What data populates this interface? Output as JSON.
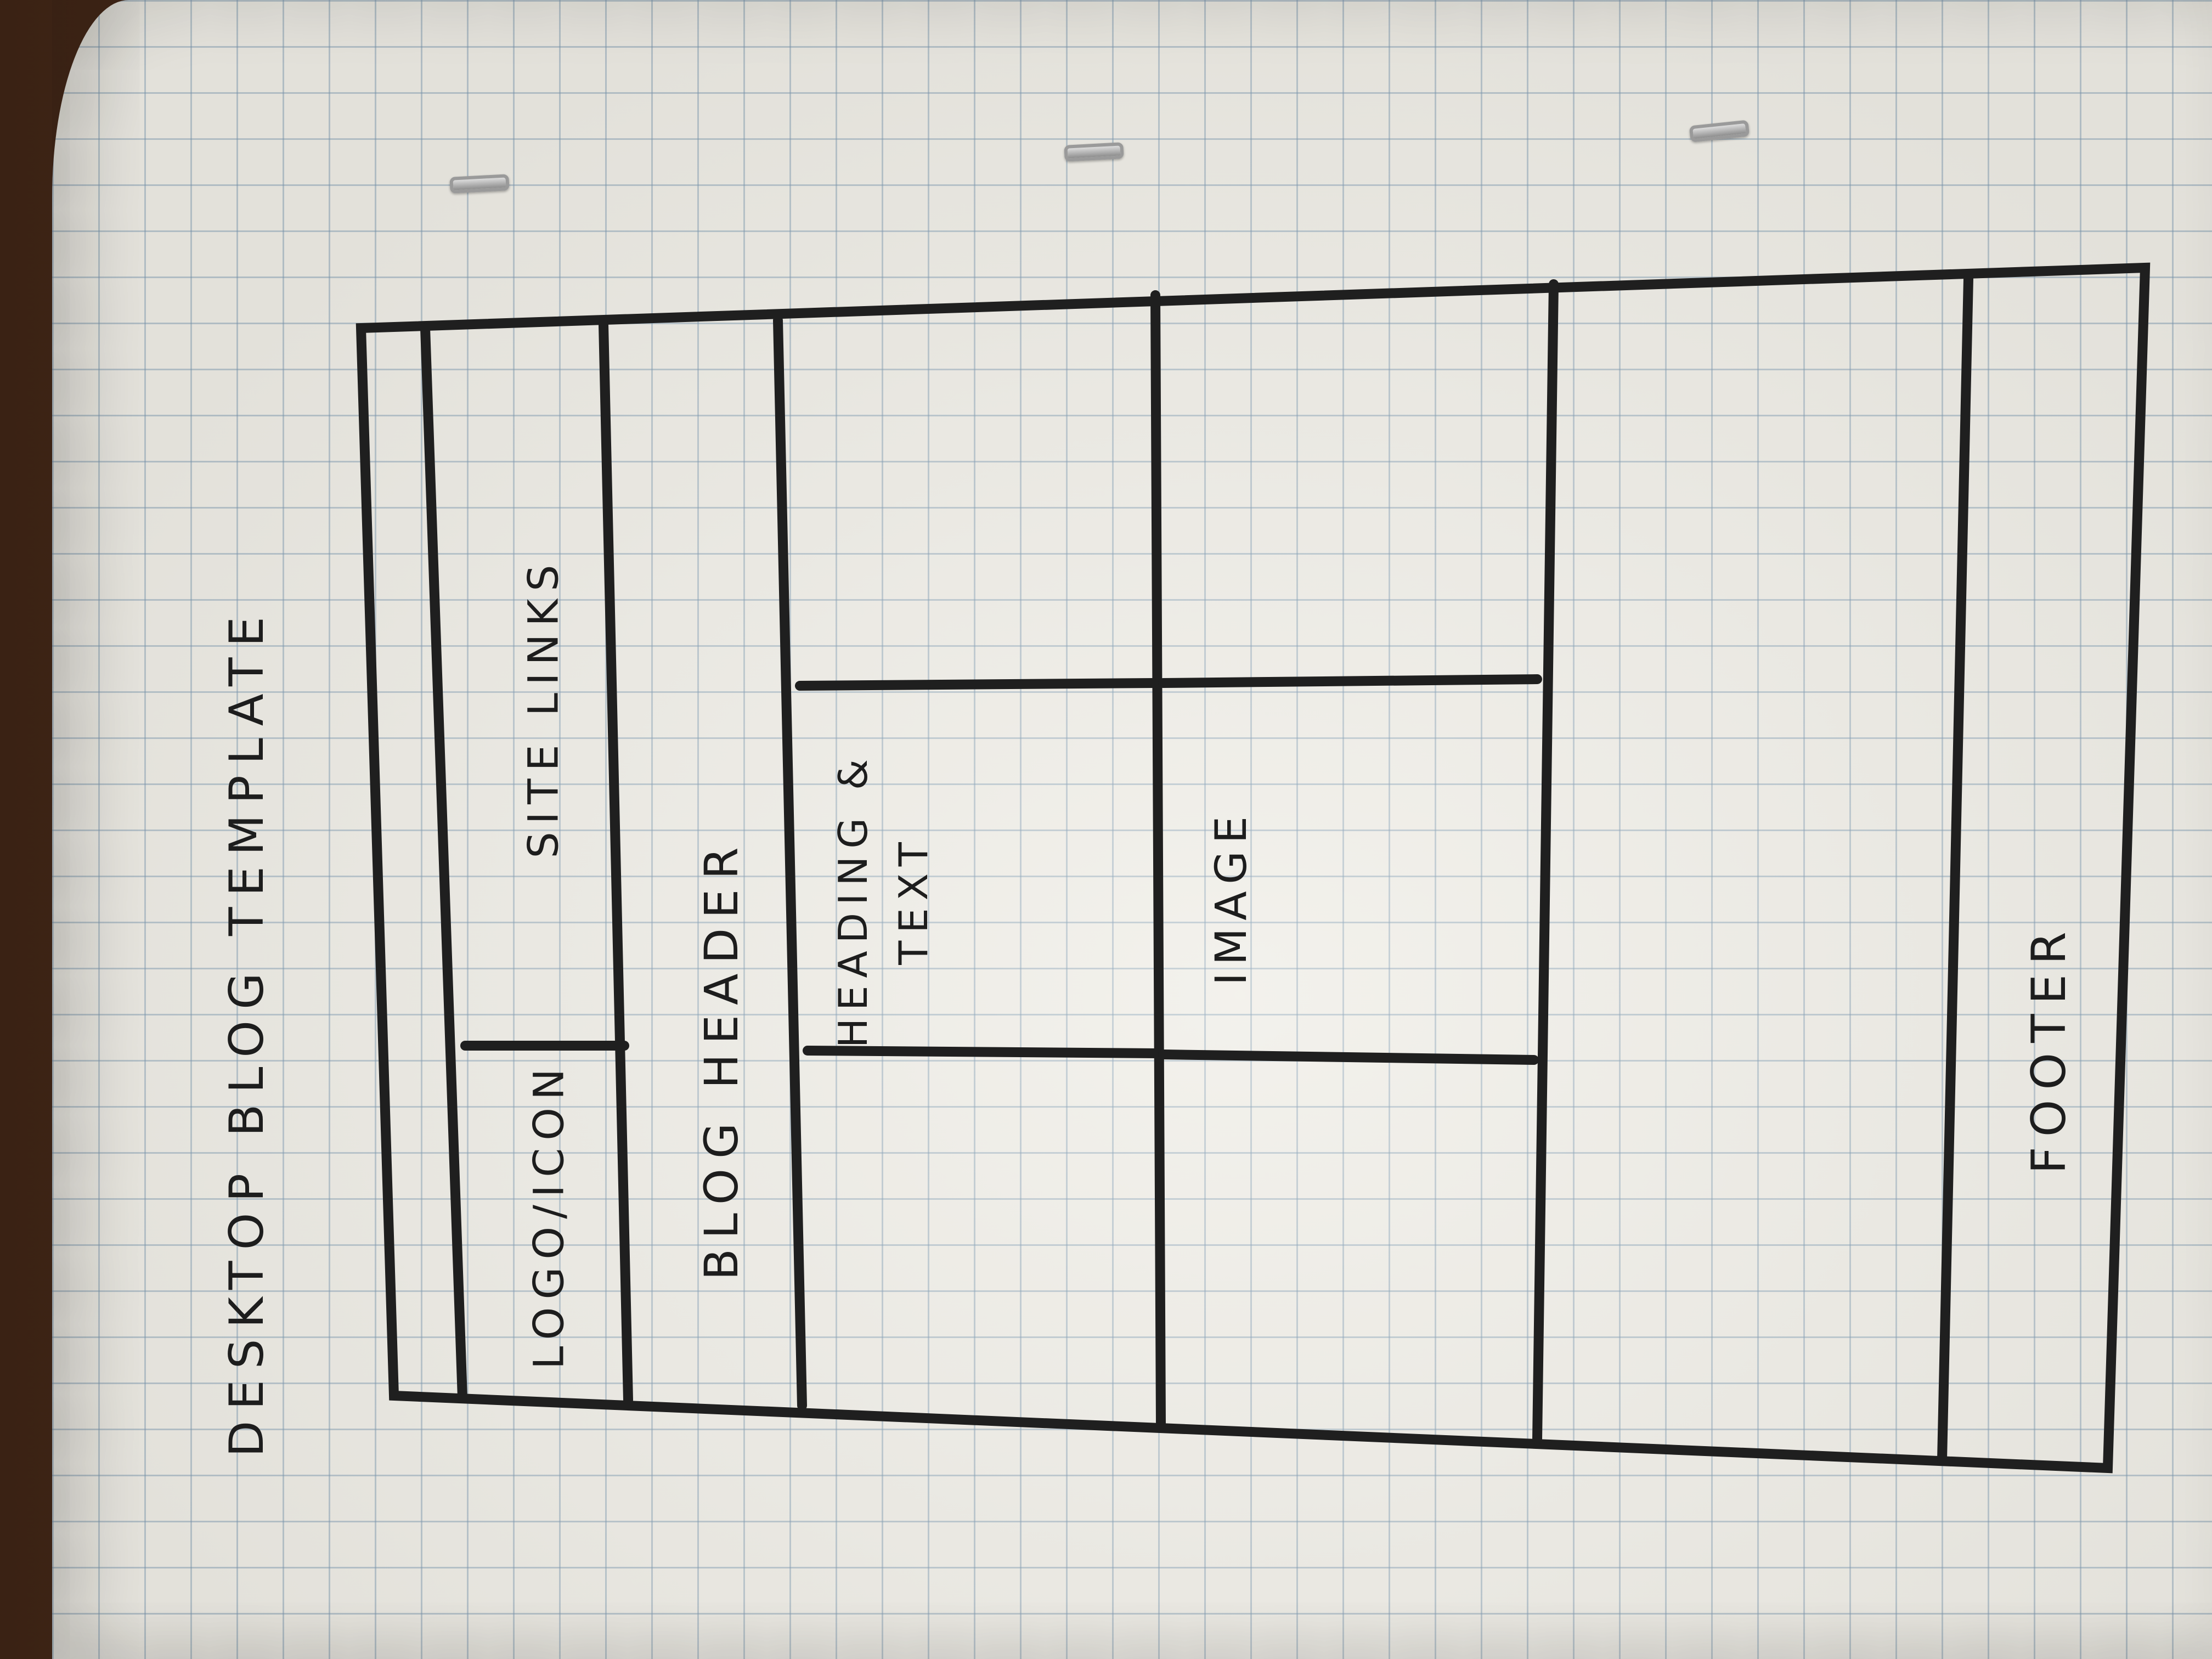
{
  "sketch": {
    "title": "Desktop Blog Template",
    "labels": {
      "site_links": "Site Links",
      "logo_icon": "Logo/Icon",
      "blog_header": "Blog Header",
      "heading_line1": "Heading &",
      "heading_line2": "Text",
      "image": "Image",
      "footer": "Footer"
    },
    "ink_color": "#1f1f1f",
    "paper_color": "#efede6",
    "grid_color": "#7896af"
  }
}
